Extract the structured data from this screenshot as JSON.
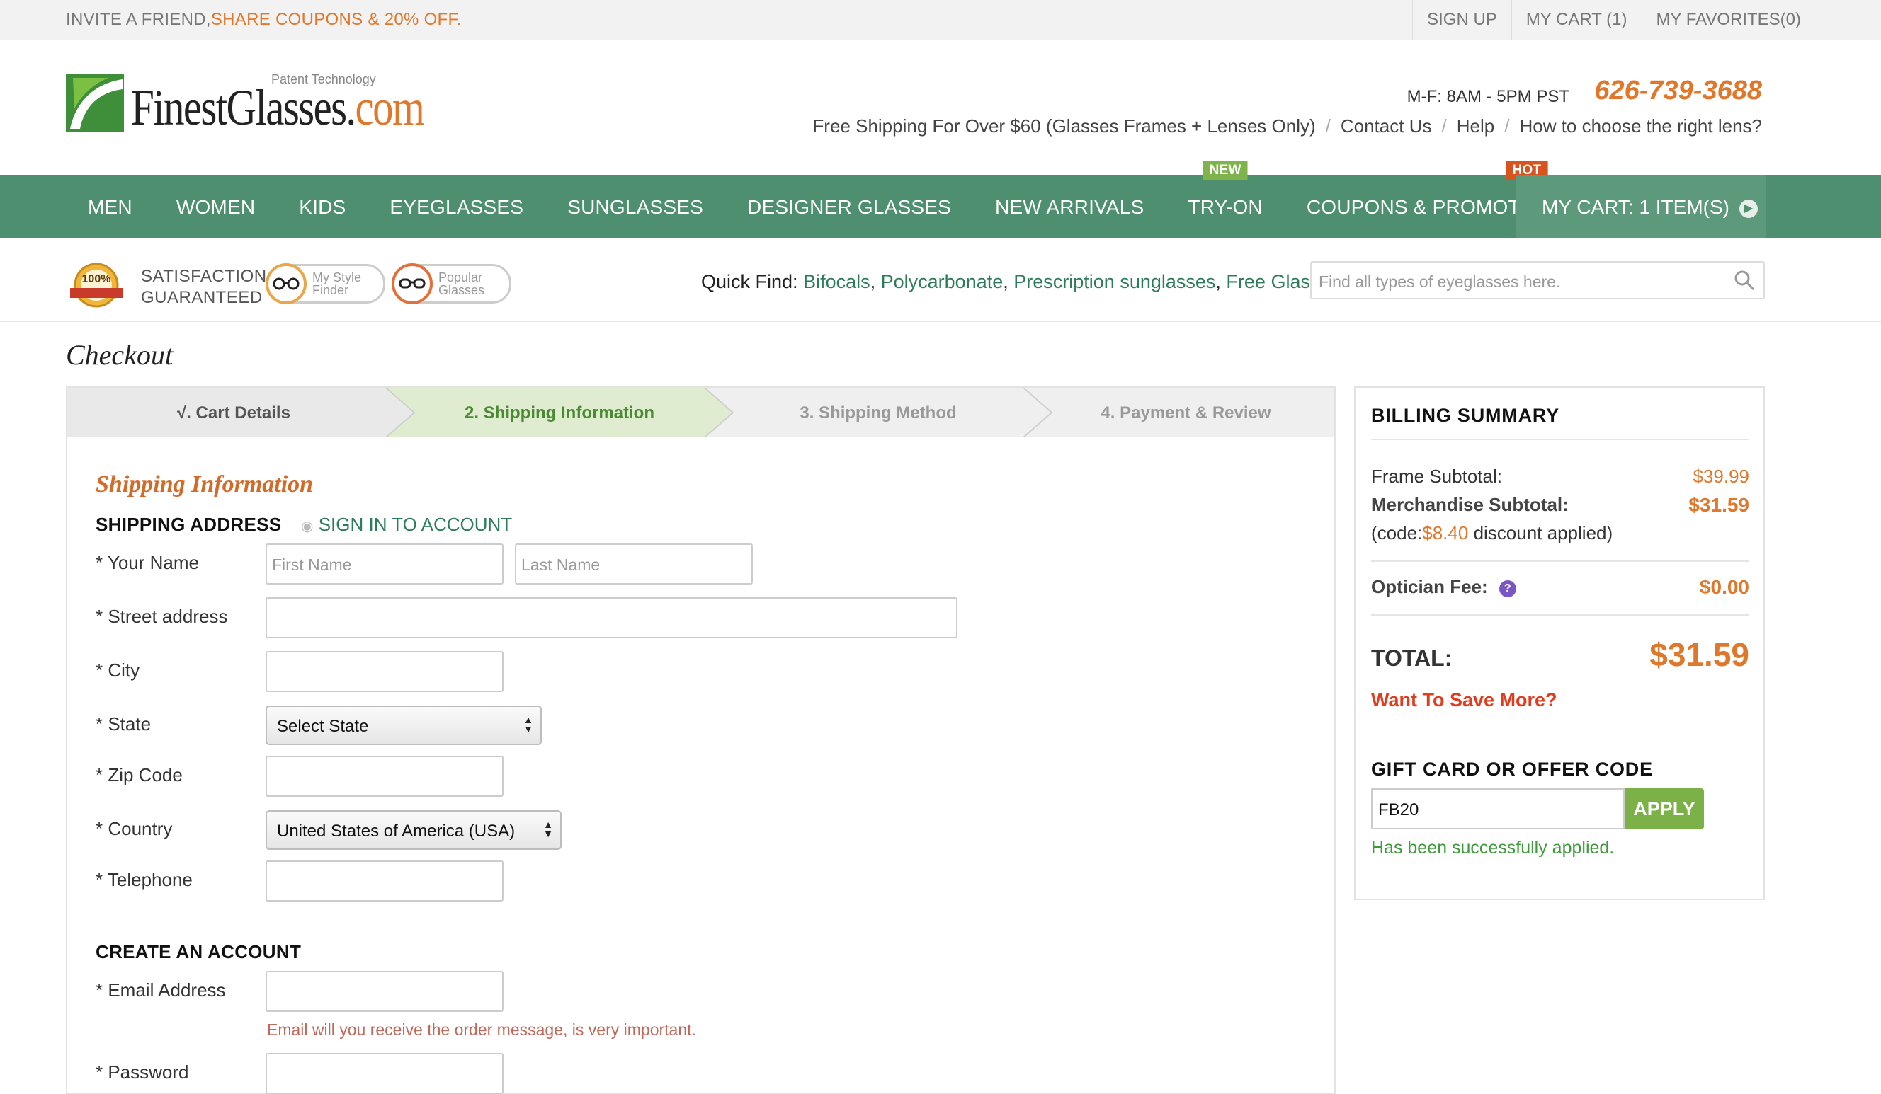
{
  "topbar": {
    "invite_prefix": "INVITE A FRIEND,",
    "invite_highlight": "SHARE COUPONS & 20% OFF.",
    "links": [
      "SIGN UP",
      "MY CART (1)",
      "MY FAVORITES(0)"
    ]
  },
  "header": {
    "brand_main": "FinestGlasses.",
    "brand_com": "com",
    "patent": "Patent Technology",
    "hours": "M-F: 8AM - 5PM PST",
    "phone": "626-739-3688",
    "info_links": [
      "Free Shipping For Over $60 (Glasses Frames + Lenses Only)",
      "Contact Us",
      "Help",
      "How to choose the right lens?"
    ]
  },
  "nav": {
    "items": [
      "MEN",
      "WOMEN",
      "KIDS",
      "EYEGLASSES",
      "SUNGLASSES",
      "DESIGNER GLASSES",
      "NEW ARRIVALS",
      "TRY-ON",
      "COUPONS & PROMOTIONS"
    ],
    "badge_new": "NEW",
    "badge_hot": "HOT",
    "cart": "MY CART: 1 ITEM(S)"
  },
  "subhead": {
    "seal_text": "100%",
    "guarantee_line1": "SATISFACTION",
    "guarantee_line2": "GUARANTEED",
    "style_finder_1": "My Style",
    "style_finder_2": "Finder",
    "popular_1": "Popular",
    "popular_2": "Glasses",
    "quickfind_label": "Quick Find:",
    "quickfind_links": [
      "Bifocals",
      "Polycarbonate",
      "Prescription sunglasses",
      "Free Glasses"
    ],
    "search_placeholder": "Find all types of eyeglasses here."
  },
  "checkout": {
    "title": "Checkout",
    "steps": [
      "√. Cart Details",
      "2. Shipping Information",
      "3. Shipping Method",
      "4. Payment & Review"
    ],
    "section_title": "Shipping Information",
    "shipping_address": "SHIPPING ADDRESS",
    "sign_in": "SIGN IN TO ACCOUNT",
    "labels": {
      "name": "* Your Name",
      "street": "* Street address",
      "city": "* City",
      "state": "* State",
      "zip": "* Zip Code",
      "country": "* Country",
      "phone": "* Telephone",
      "email": "* Email Address",
      "password": "* Password"
    },
    "placeholders": {
      "first": "First Name",
      "last": "Last Name"
    },
    "state_value": "Select State",
    "country_value": "United States of America (USA)",
    "create_account": "CREATE AN ACCOUNT",
    "email_hint": "Email will you receive the order message, is very important."
  },
  "billing": {
    "title": "BILLING SUMMARY",
    "frame_label": "Frame Subtotal:",
    "frame_value": "$39.99",
    "merch_label": "Merchandise Subtotal:",
    "merch_value": "$31.59",
    "discount_prefix": "(code:",
    "discount_amount": "$8.40",
    "discount_suffix": " discount applied)",
    "optician_label": "Optician Fee:",
    "optician_value": "$0.00",
    "total_label": "TOTAL:",
    "total_value": "$31.59",
    "want_more": "Want To Save More?",
    "gift_title": "GIFT CARD OR OFFER CODE",
    "code_value": "FB20",
    "apply": "APPLY",
    "success": "Has been successfully applied."
  },
  "colors": {
    "nav_green": "#4d8f6e",
    "accent_orange": "#e0782c",
    "apply_green": "#7bb147",
    "success_green": "#3f9a3b",
    "warn_red": "#e23c1f"
  }
}
